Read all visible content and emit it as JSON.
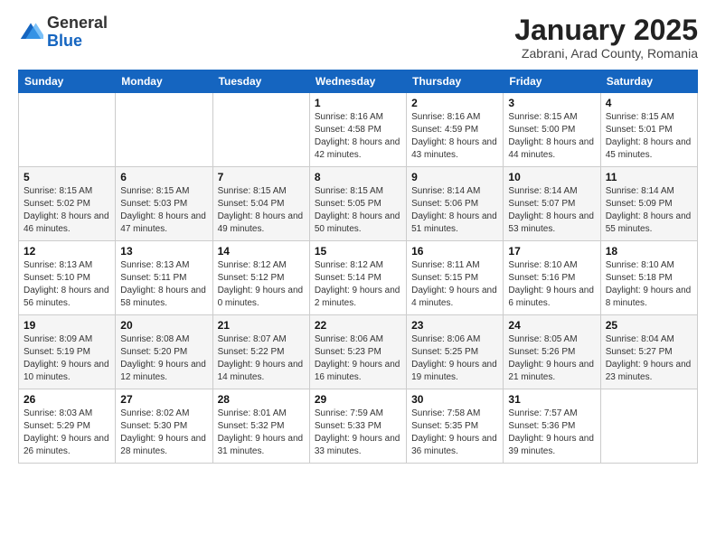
{
  "header": {
    "logo": {
      "general": "General",
      "blue": "Blue"
    },
    "title": "January 2025",
    "subtitle": "Zabrani, Arad County, Romania"
  },
  "days_of_week": [
    "Sunday",
    "Monday",
    "Tuesday",
    "Wednesday",
    "Thursday",
    "Friday",
    "Saturday"
  ],
  "weeks": [
    [
      {
        "day": "",
        "info": ""
      },
      {
        "day": "",
        "info": ""
      },
      {
        "day": "",
        "info": ""
      },
      {
        "day": "1",
        "info": "Sunrise: 8:16 AM\nSunset: 4:58 PM\nDaylight: 8 hours and 42 minutes."
      },
      {
        "day": "2",
        "info": "Sunrise: 8:16 AM\nSunset: 4:59 PM\nDaylight: 8 hours and 43 minutes."
      },
      {
        "day": "3",
        "info": "Sunrise: 8:15 AM\nSunset: 5:00 PM\nDaylight: 8 hours and 44 minutes."
      },
      {
        "day": "4",
        "info": "Sunrise: 8:15 AM\nSunset: 5:01 PM\nDaylight: 8 hours and 45 minutes."
      }
    ],
    [
      {
        "day": "5",
        "info": "Sunrise: 8:15 AM\nSunset: 5:02 PM\nDaylight: 8 hours and 46 minutes."
      },
      {
        "day": "6",
        "info": "Sunrise: 8:15 AM\nSunset: 5:03 PM\nDaylight: 8 hours and 47 minutes."
      },
      {
        "day": "7",
        "info": "Sunrise: 8:15 AM\nSunset: 5:04 PM\nDaylight: 8 hours and 49 minutes."
      },
      {
        "day": "8",
        "info": "Sunrise: 8:15 AM\nSunset: 5:05 PM\nDaylight: 8 hours and 50 minutes."
      },
      {
        "day": "9",
        "info": "Sunrise: 8:14 AM\nSunset: 5:06 PM\nDaylight: 8 hours and 51 minutes."
      },
      {
        "day": "10",
        "info": "Sunrise: 8:14 AM\nSunset: 5:07 PM\nDaylight: 8 hours and 53 minutes."
      },
      {
        "day": "11",
        "info": "Sunrise: 8:14 AM\nSunset: 5:09 PM\nDaylight: 8 hours and 55 minutes."
      }
    ],
    [
      {
        "day": "12",
        "info": "Sunrise: 8:13 AM\nSunset: 5:10 PM\nDaylight: 8 hours and 56 minutes."
      },
      {
        "day": "13",
        "info": "Sunrise: 8:13 AM\nSunset: 5:11 PM\nDaylight: 8 hours and 58 minutes."
      },
      {
        "day": "14",
        "info": "Sunrise: 8:12 AM\nSunset: 5:12 PM\nDaylight: 9 hours and 0 minutes."
      },
      {
        "day": "15",
        "info": "Sunrise: 8:12 AM\nSunset: 5:14 PM\nDaylight: 9 hours and 2 minutes."
      },
      {
        "day": "16",
        "info": "Sunrise: 8:11 AM\nSunset: 5:15 PM\nDaylight: 9 hours and 4 minutes."
      },
      {
        "day": "17",
        "info": "Sunrise: 8:10 AM\nSunset: 5:16 PM\nDaylight: 9 hours and 6 minutes."
      },
      {
        "day": "18",
        "info": "Sunrise: 8:10 AM\nSunset: 5:18 PM\nDaylight: 9 hours and 8 minutes."
      }
    ],
    [
      {
        "day": "19",
        "info": "Sunrise: 8:09 AM\nSunset: 5:19 PM\nDaylight: 9 hours and 10 minutes."
      },
      {
        "day": "20",
        "info": "Sunrise: 8:08 AM\nSunset: 5:20 PM\nDaylight: 9 hours and 12 minutes."
      },
      {
        "day": "21",
        "info": "Sunrise: 8:07 AM\nSunset: 5:22 PM\nDaylight: 9 hours and 14 minutes."
      },
      {
        "day": "22",
        "info": "Sunrise: 8:06 AM\nSunset: 5:23 PM\nDaylight: 9 hours and 16 minutes."
      },
      {
        "day": "23",
        "info": "Sunrise: 8:06 AM\nSunset: 5:25 PM\nDaylight: 9 hours and 19 minutes."
      },
      {
        "day": "24",
        "info": "Sunrise: 8:05 AM\nSunset: 5:26 PM\nDaylight: 9 hours and 21 minutes."
      },
      {
        "day": "25",
        "info": "Sunrise: 8:04 AM\nSunset: 5:27 PM\nDaylight: 9 hours and 23 minutes."
      }
    ],
    [
      {
        "day": "26",
        "info": "Sunrise: 8:03 AM\nSunset: 5:29 PM\nDaylight: 9 hours and 26 minutes."
      },
      {
        "day": "27",
        "info": "Sunrise: 8:02 AM\nSunset: 5:30 PM\nDaylight: 9 hours and 28 minutes."
      },
      {
        "day": "28",
        "info": "Sunrise: 8:01 AM\nSunset: 5:32 PM\nDaylight: 9 hours and 31 minutes."
      },
      {
        "day": "29",
        "info": "Sunrise: 7:59 AM\nSunset: 5:33 PM\nDaylight: 9 hours and 33 minutes."
      },
      {
        "day": "30",
        "info": "Sunrise: 7:58 AM\nSunset: 5:35 PM\nDaylight: 9 hours and 36 minutes."
      },
      {
        "day": "31",
        "info": "Sunrise: 7:57 AM\nSunset: 5:36 PM\nDaylight: 9 hours and 39 minutes."
      },
      {
        "day": "",
        "info": ""
      }
    ]
  ]
}
